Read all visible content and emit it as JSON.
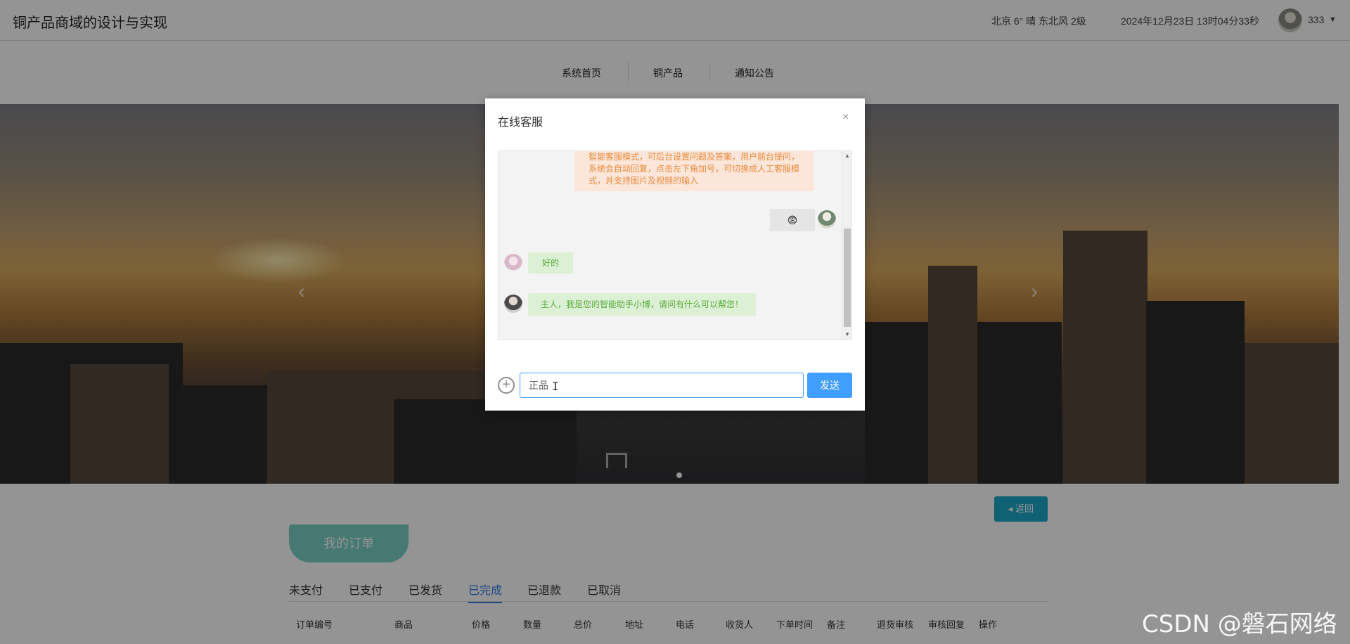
{
  "header": {
    "site_title": "铜产品商域的设计与实现",
    "weather": "北京  6°  晴  东北风  2级",
    "datetime": "2024年12月23日 13时04分33秒",
    "username": "333"
  },
  "nav": {
    "items": [
      "系统首页",
      "铜产品",
      "通知公告"
    ]
  },
  "banner": {
    "prev_glyph": "‹",
    "next_glyph": "›"
  },
  "page": {
    "back_label": "◂ 返回",
    "orders_tab_label": "我的订单",
    "status_tabs": [
      "未支付",
      "已支付",
      "已发货",
      "已完成",
      "已退款",
      "已取消"
    ],
    "active_status": "已完成",
    "columns": [
      "订单编号",
      "商品",
      "价格",
      "数量",
      "总价",
      "地址",
      "电话",
      "收货人",
      "下单时间",
      "备注",
      "退货审核",
      "审核回复",
      "操作"
    ]
  },
  "dialog": {
    "title": "在线客服",
    "close_glyph": "×",
    "messages": {
      "intro": "智能客服模式，可后台设置问题及答案，用户前台提问，系统会自动回复，点击左下角加号，可切换成人工客服模式，并支持图片及视频的输入",
      "user_emoji": "😨",
      "bot_reply": "好的",
      "bot_greeting": "主人，我是您的智能助手小博，请问有什么可以帮您！"
    },
    "input_value": "正品",
    "send_label": "发送"
  },
  "watermark": "CSDN @磐石网络",
  "colors": {
    "accent": "#409eff",
    "back_button": "#1ba7c7",
    "orders_tab": "#77d0c5",
    "bubble_green_bg": "#dcf0d6",
    "bubble_orange_bg": "#fbe6d9"
  }
}
